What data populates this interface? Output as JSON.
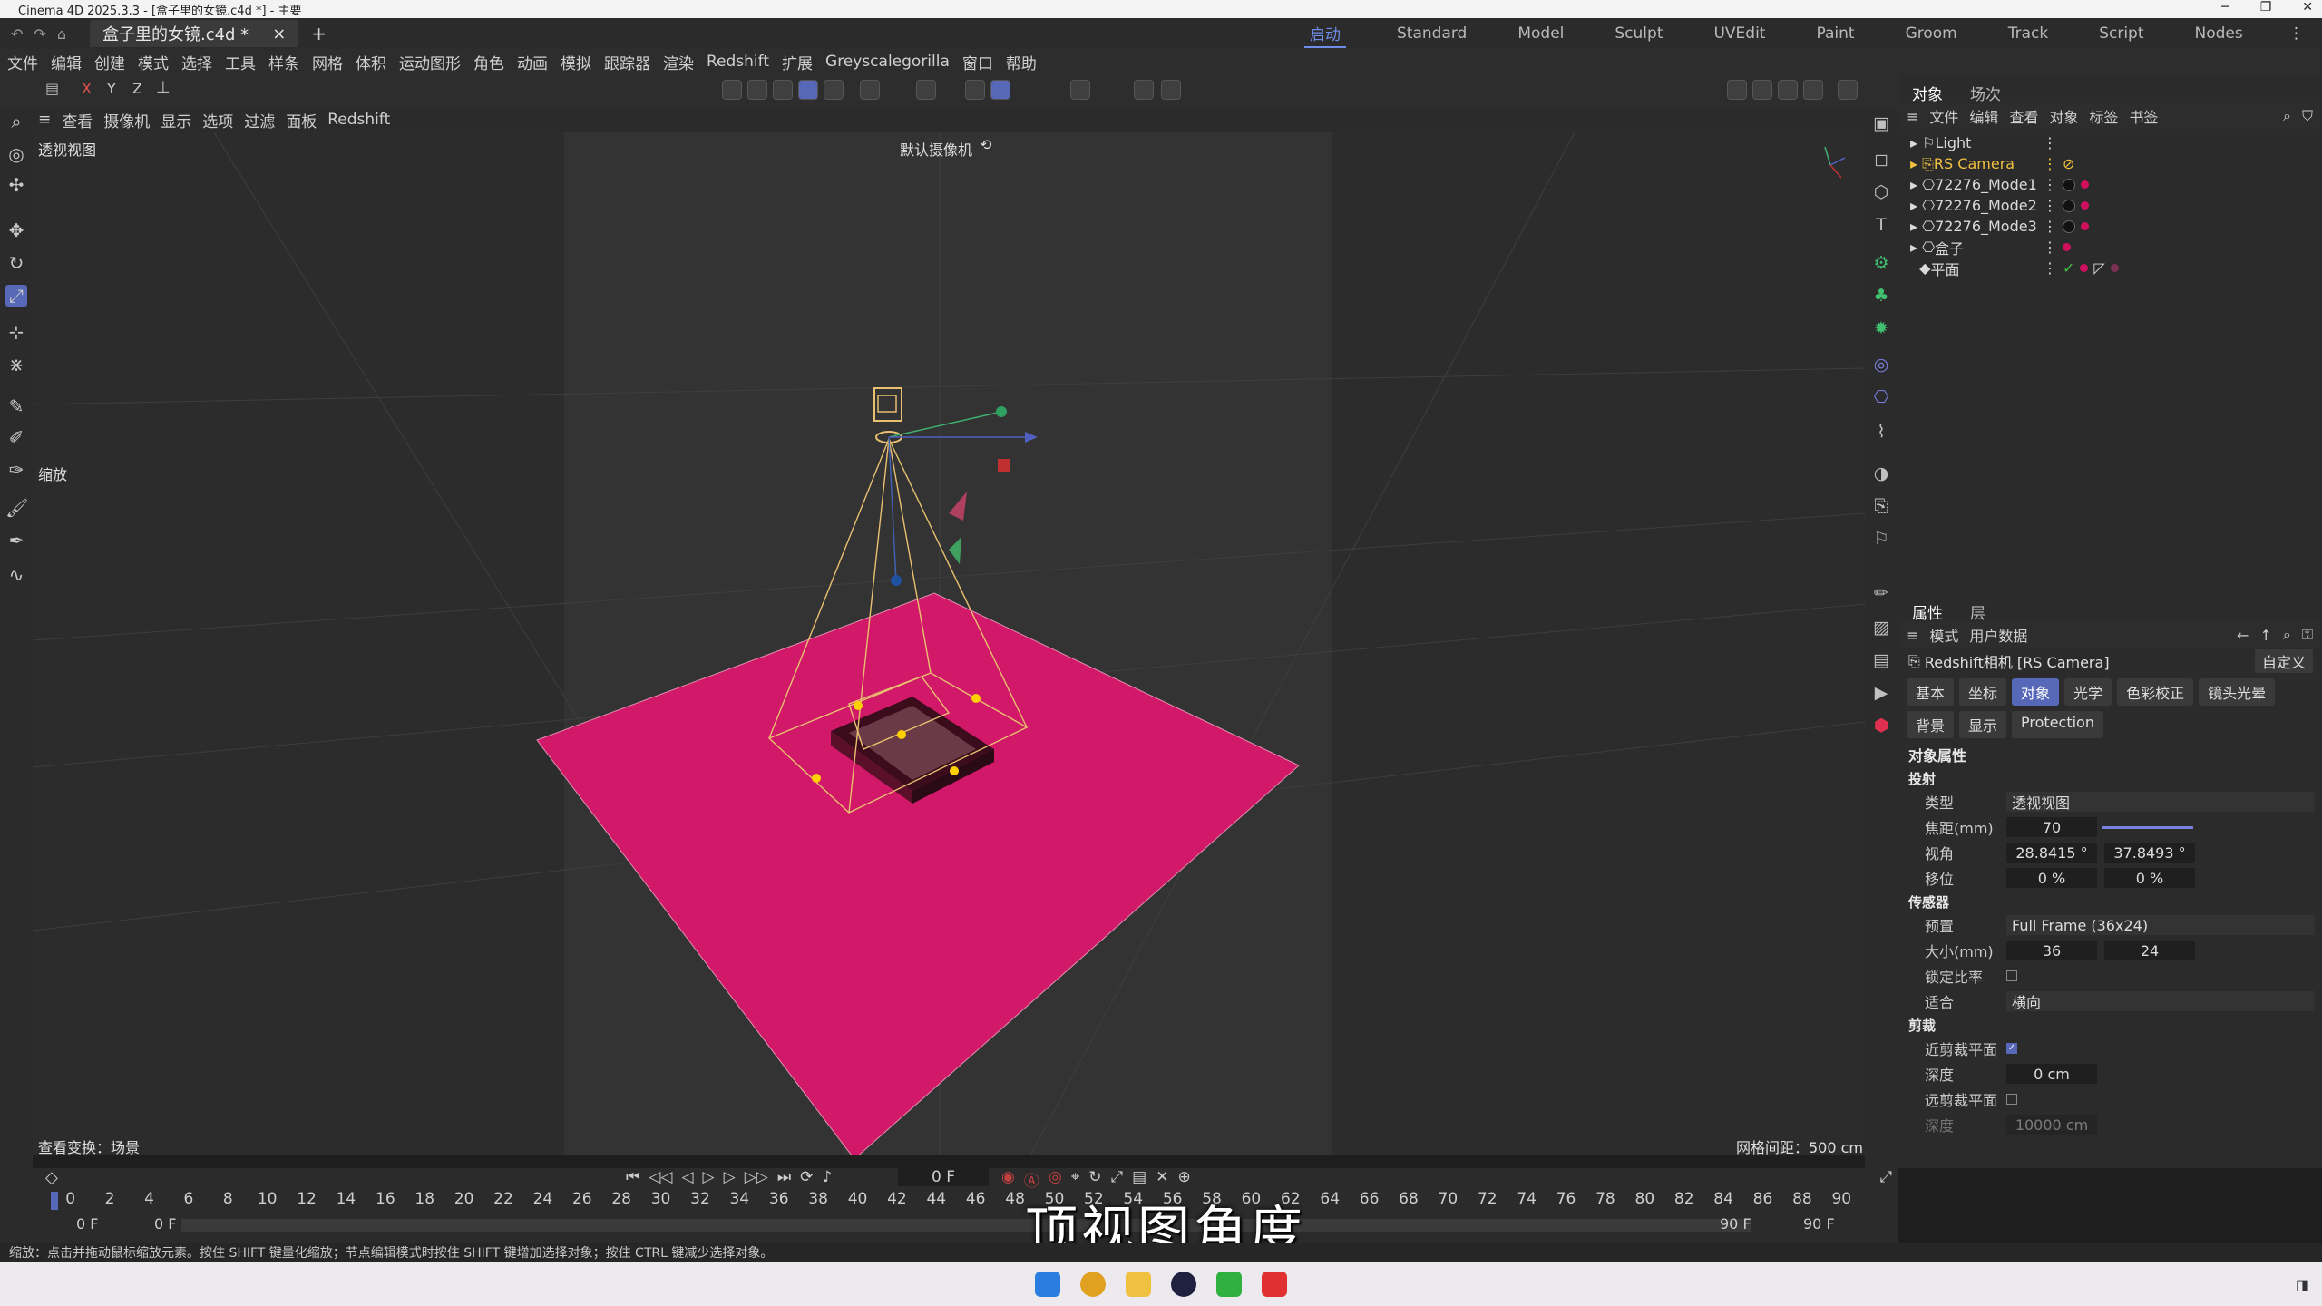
{
  "window": {
    "title": "Cinema 4D 2025.3.3 - [盒子里的女镜.c4d *] - 主要"
  },
  "tabs": {
    "doc": "盒子里的女镜.c4d *",
    "close": "×",
    "add": "+"
  },
  "layouts": [
    "启动",
    "Standard",
    "Model",
    "Sculpt",
    "UVEdit",
    "Paint",
    "Groom",
    "Track",
    "Script",
    "Nodes"
  ],
  "menu": [
    "文件",
    "编辑",
    "创建",
    "模式",
    "选择",
    "工具",
    "样条",
    "网格",
    "体积",
    "运动图形",
    "角色",
    "动画",
    "模拟",
    "跟踪器",
    "渲染",
    "Redshift",
    "扩展",
    "Greyscalegorilla",
    "窗口",
    "帮助"
  ],
  "axes": {
    "x": "X",
    "y": "Y",
    "z": "Z"
  },
  "viewport_menu": [
    "查看",
    "摄像机",
    "显示",
    "选项",
    "过滤",
    "面板",
    "Redshift"
  ],
  "viewport": {
    "name": "透视视图",
    "camera": "默认摄像机",
    "zoom_label": "缩放",
    "view_transform": "查看变换：场景",
    "grid_spacing": "网格间距：500 cm"
  },
  "object_panel": {
    "tabs": [
      "对象",
      "场次"
    ],
    "menu": [
      "文件",
      "编辑",
      "查看",
      "对象",
      "标签",
      "书签"
    ],
    "objects": [
      {
        "name": "Light",
        "highlight": false
      },
      {
        "name": "RS Camera",
        "highlight": true
      },
      {
        "name": "72276_Mode1",
        "highlight": false
      },
      {
        "name": "72276_Mode2",
        "highlight": false
      },
      {
        "name": "72276_Mode3",
        "highlight": false
      },
      {
        "name": "盒子",
        "highlight": false
      },
      {
        "name": "平面",
        "highlight": false
      }
    ]
  },
  "attr_panel": {
    "tabs": [
      "属性",
      "层"
    ],
    "menu": [
      "模式",
      "用户数据"
    ],
    "object_title": "Redshift相机 [RS Camera]",
    "preset": "自定义",
    "subtabs_row1": [
      "基本",
      "坐标",
      "对象",
      "光学",
      "色彩校正",
      "镜头光晕"
    ],
    "subtabs_row2": [
      "背景",
      "显示",
      "Protection"
    ],
    "section": "对象属性",
    "projection_header": "投射",
    "type_label": "类型",
    "type_value": "透视视图",
    "focal_label": "焦距(mm)",
    "focal_value": "70",
    "fov_label": "视角",
    "fov_h": "28.8415 °",
    "fov_v": "37.8493 °",
    "shift_label": "移位",
    "shift_x": "0 %",
    "shift_y": "0 %",
    "sensor_header": "传感器",
    "preset_label": "预置",
    "preset_value": "Full Frame (36x24)",
    "size_label": "大小(mm)",
    "size_w": "36",
    "size_h": "24",
    "lock_label": "锁定比率",
    "fit_label": "适合",
    "fit_value": "横向",
    "clip_header": "剪裁",
    "near_label": "近剪裁平面",
    "near_depth_label": "深度",
    "near_depth": "0 cm",
    "far_label": "远剪裁平面",
    "far_depth_label": "深度",
    "far_depth": "10000 cm"
  },
  "timeline": {
    "current": "0 F",
    "ticks": [
      "0",
      "2",
      "4",
      "6",
      "8",
      "10",
      "12",
      "14",
      "16",
      "18",
      "20",
      "22",
      "24",
      "26",
      "28",
      "30",
      "32",
      "34",
      "36",
      "38",
      "40",
      "42",
      "44",
      "46",
      "48",
      "50",
      "52",
      "54",
      "56",
      "58",
      "60",
      "62",
      "64",
      "66",
      "68",
      "70",
      "72",
      "74",
      "76",
      "78",
      "80",
      "82",
      "84",
      "86",
      "88",
      "90"
    ],
    "start_a": "0 F",
    "start_b": "0 F",
    "end_a": "90 F",
    "end_b": "90 F"
  },
  "status": "缩放：点击并拖动鼠标缩放元素。按住 SHIFT 键量化缩放；节点编辑模式时按住 SHIFT 键增加选择对象；按住 CTRL 键减少选择对象。",
  "subtitle": "顶视图角度",
  "colors": {
    "accent": "#5868b8",
    "plane": "#d21868",
    "camera": "#e8c070"
  }
}
